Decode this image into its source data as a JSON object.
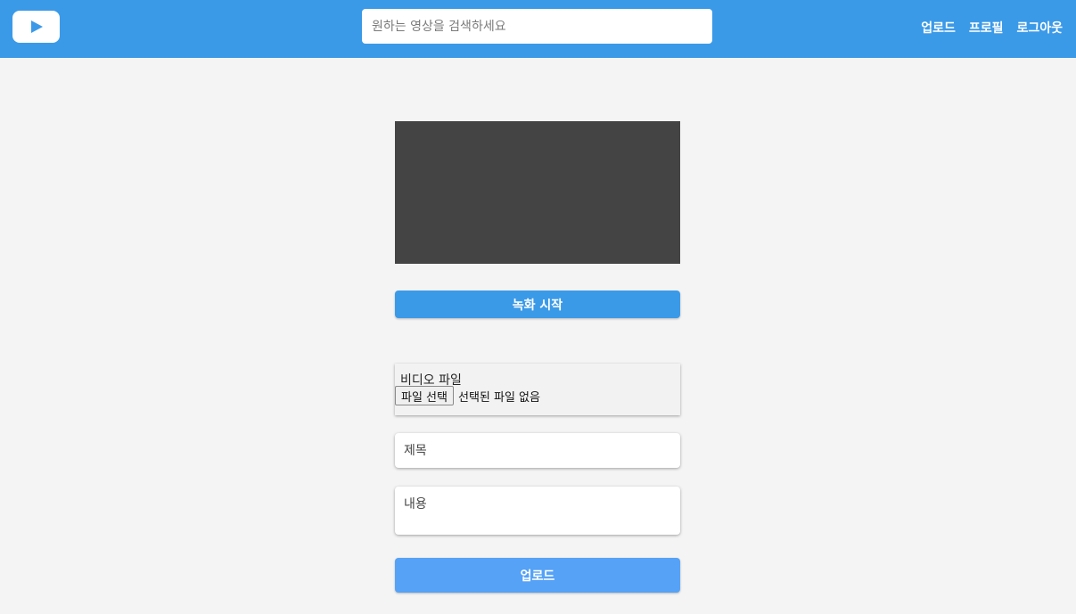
{
  "header": {
    "logo_icon": "play-icon",
    "search_placeholder": "원하는 영상을 검색하세요",
    "nav": {
      "upload": "업로드",
      "profile": "프로필",
      "logout": "로그아웃"
    }
  },
  "recorder": {
    "start_label": "녹화 시작"
  },
  "form": {
    "file_label": "비디오 파일",
    "file_button": "파일 선택",
    "file_status": "선택된 파일 없음",
    "title_placeholder": "제목",
    "content_placeholder": "내용",
    "submit_label": "업로드"
  },
  "colors": {
    "header_bg": "#3b9ae8",
    "page_bg": "#f4f4f4",
    "preview_bg": "#444444",
    "record_button": "#3b9ae8",
    "upload_button": "#55a2f7"
  }
}
